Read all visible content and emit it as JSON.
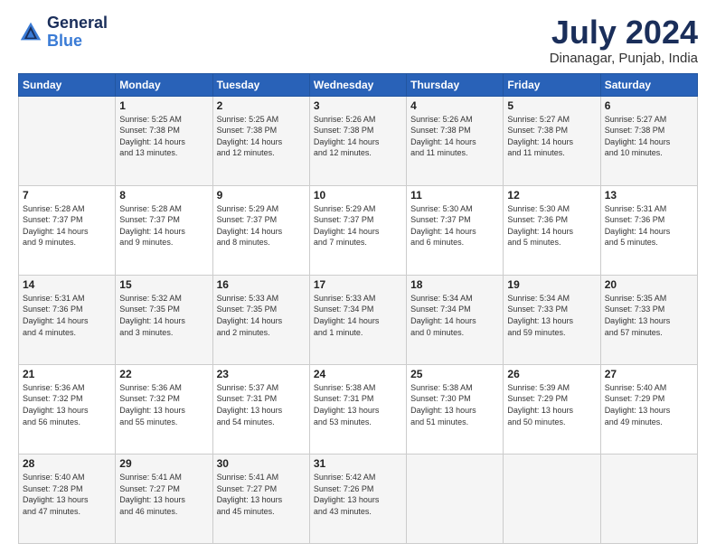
{
  "header": {
    "logo_line1": "General",
    "logo_line2": "Blue",
    "month": "July 2024",
    "location": "Dinanagar, Punjab, India"
  },
  "weekdays": [
    "Sunday",
    "Monday",
    "Tuesday",
    "Wednesday",
    "Thursday",
    "Friday",
    "Saturday"
  ],
  "rows": [
    [
      {
        "day": "",
        "info": ""
      },
      {
        "day": "1",
        "info": "Sunrise: 5:25 AM\nSunset: 7:38 PM\nDaylight: 14 hours\nand 13 minutes."
      },
      {
        "day": "2",
        "info": "Sunrise: 5:25 AM\nSunset: 7:38 PM\nDaylight: 14 hours\nand 12 minutes."
      },
      {
        "day": "3",
        "info": "Sunrise: 5:26 AM\nSunset: 7:38 PM\nDaylight: 14 hours\nand 12 minutes."
      },
      {
        "day": "4",
        "info": "Sunrise: 5:26 AM\nSunset: 7:38 PM\nDaylight: 14 hours\nand 11 minutes."
      },
      {
        "day": "5",
        "info": "Sunrise: 5:27 AM\nSunset: 7:38 PM\nDaylight: 14 hours\nand 11 minutes."
      },
      {
        "day": "6",
        "info": "Sunrise: 5:27 AM\nSunset: 7:38 PM\nDaylight: 14 hours\nand 10 minutes."
      }
    ],
    [
      {
        "day": "7",
        "info": "Sunrise: 5:28 AM\nSunset: 7:37 PM\nDaylight: 14 hours\nand 9 minutes."
      },
      {
        "day": "8",
        "info": "Sunrise: 5:28 AM\nSunset: 7:37 PM\nDaylight: 14 hours\nand 9 minutes."
      },
      {
        "day": "9",
        "info": "Sunrise: 5:29 AM\nSunset: 7:37 PM\nDaylight: 14 hours\nand 8 minutes."
      },
      {
        "day": "10",
        "info": "Sunrise: 5:29 AM\nSunset: 7:37 PM\nDaylight: 14 hours\nand 7 minutes."
      },
      {
        "day": "11",
        "info": "Sunrise: 5:30 AM\nSunset: 7:37 PM\nDaylight: 14 hours\nand 6 minutes."
      },
      {
        "day": "12",
        "info": "Sunrise: 5:30 AM\nSunset: 7:36 PM\nDaylight: 14 hours\nand 5 minutes."
      },
      {
        "day": "13",
        "info": "Sunrise: 5:31 AM\nSunset: 7:36 PM\nDaylight: 14 hours\nand 5 minutes."
      }
    ],
    [
      {
        "day": "14",
        "info": "Sunrise: 5:31 AM\nSunset: 7:36 PM\nDaylight: 14 hours\nand 4 minutes."
      },
      {
        "day": "15",
        "info": "Sunrise: 5:32 AM\nSunset: 7:35 PM\nDaylight: 14 hours\nand 3 minutes."
      },
      {
        "day": "16",
        "info": "Sunrise: 5:33 AM\nSunset: 7:35 PM\nDaylight: 14 hours\nand 2 minutes."
      },
      {
        "day": "17",
        "info": "Sunrise: 5:33 AM\nSunset: 7:34 PM\nDaylight: 14 hours\nand 1 minute."
      },
      {
        "day": "18",
        "info": "Sunrise: 5:34 AM\nSunset: 7:34 PM\nDaylight: 14 hours\nand 0 minutes."
      },
      {
        "day": "19",
        "info": "Sunrise: 5:34 AM\nSunset: 7:33 PM\nDaylight: 13 hours\nand 59 minutes."
      },
      {
        "day": "20",
        "info": "Sunrise: 5:35 AM\nSunset: 7:33 PM\nDaylight: 13 hours\nand 57 minutes."
      }
    ],
    [
      {
        "day": "21",
        "info": "Sunrise: 5:36 AM\nSunset: 7:32 PM\nDaylight: 13 hours\nand 56 minutes."
      },
      {
        "day": "22",
        "info": "Sunrise: 5:36 AM\nSunset: 7:32 PM\nDaylight: 13 hours\nand 55 minutes."
      },
      {
        "day": "23",
        "info": "Sunrise: 5:37 AM\nSunset: 7:31 PM\nDaylight: 13 hours\nand 54 minutes."
      },
      {
        "day": "24",
        "info": "Sunrise: 5:38 AM\nSunset: 7:31 PM\nDaylight: 13 hours\nand 53 minutes."
      },
      {
        "day": "25",
        "info": "Sunrise: 5:38 AM\nSunset: 7:30 PM\nDaylight: 13 hours\nand 51 minutes."
      },
      {
        "day": "26",
        "info": "Sunrise: 5:39 AM\nSunset: 7:29 PM\nDaylight: 13 hours\nand 50 minutes."
      },
      {
        "day": "27",
        "info": "Sunrise: 5:40 AM\nSunset: 7:29 PM\nDaylight: 13 hours\nand 49 minutes."
      }
    ],
    [
      {
        "day": "28",
        "info": "Sunrise: 5:40 AM\nSunset: 7:28 PM\nDaylight: 13 hours\nand 47 minutes."
      },
      {
        "day": "29",
        "info": "Sunrise: 5:41 AM\nSunset: 7:27 PM\nDaylight: 13 hours\nand 46 minutes."
      },
      {
        "day": "30",
        "info": "Sunrise: 5:41 AM\nSunset: 7:27 PM\nDaylight: 13 hours\nand 45 minutes."
      },
      {
        "day": "31",
        "info": "Sunrise: 5:42 AM\nSunset: 7:26 PM\nDaylight: 13 hours\nand 43 minutes."
      },
      {
        "day": "",
        "info": ""
      },
      {
        "day": "",
        "info": ""
      },
      {
        "day": "",
        "info": ""
      }
    ]
  ]
}
